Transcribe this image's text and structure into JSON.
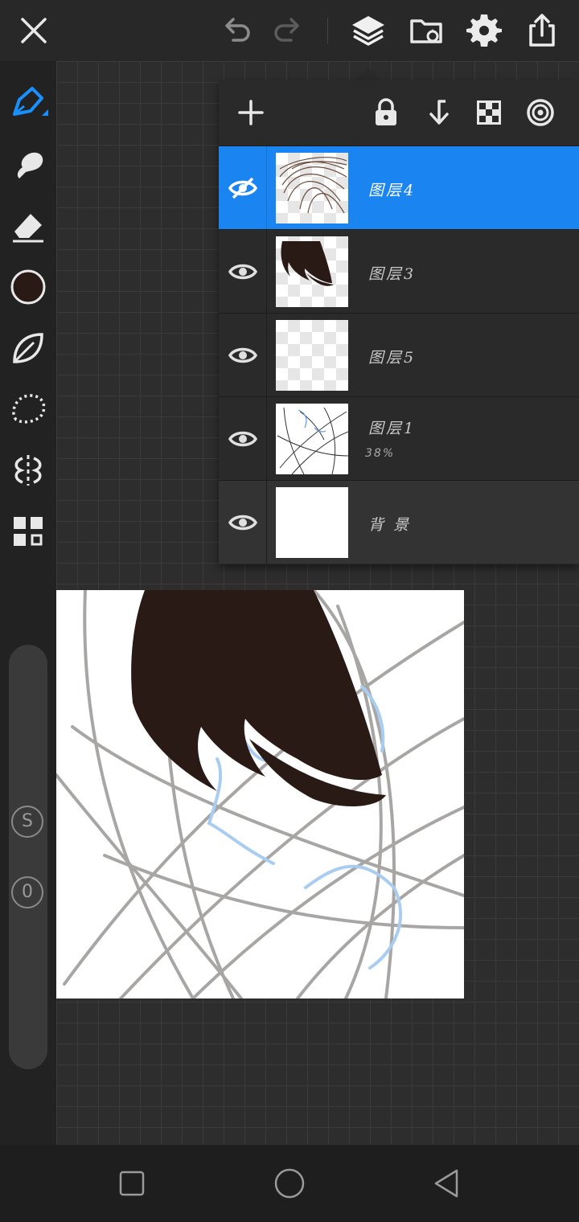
{
  "toolbar": {
    "icons": [
      "close-icon",
      "undo-icon",
      "redo-icon",
      "layers-icon",
      "import-icon",
      "settings-icon",
      "share-icon"
    ]
  },
  "tools": {
    "items": [
      "pen-icon",
      "smudge-icon",
      "eraser-icon",
      "color-swatch",
      "leaf-brush-icon",
      "lasso-icon",
      "symmetry-icon",
      "grid-menu-icon"
    ],
    "current_color": "#2a1a15",
    "size_badge": "S",
    "opacity_badge": "0"
  },
  "layers_panel": {
    "actions": [
      "add-layer-icon",
      "lock-icon",
      "merge-down-icon",
      "transparency-icon",
      "blend-mode-icon"
    ],
    "layers": [
      {
        "name": "图层4",
        "selected": true,
        "visible": true
      },
      {
        "name": "图层3",
        "selected": false,
        "visible": true
      },
      {
        "name": "图层5",
        "selected": false,
        "visible": true
      },
      {
        "name": "图层1",
        "opacity": "38%",
        "selected": false,
        "visible": true
      },
      {
        "name": "背 景",
        "selected": false,
        "visible": true
      }
    ]
  },
  "colors": {
    "accent": "#1a84f0",
    "hair": "#2a1a15",
    "sketch": "#a8a6a4",
    "lineart_blue": "#a9cdf0"
  },
  "navbar": {
    "icons": [
      "recent-apps-icon",
      "home-icon",
      "back-icon"
    ]
  }
}
